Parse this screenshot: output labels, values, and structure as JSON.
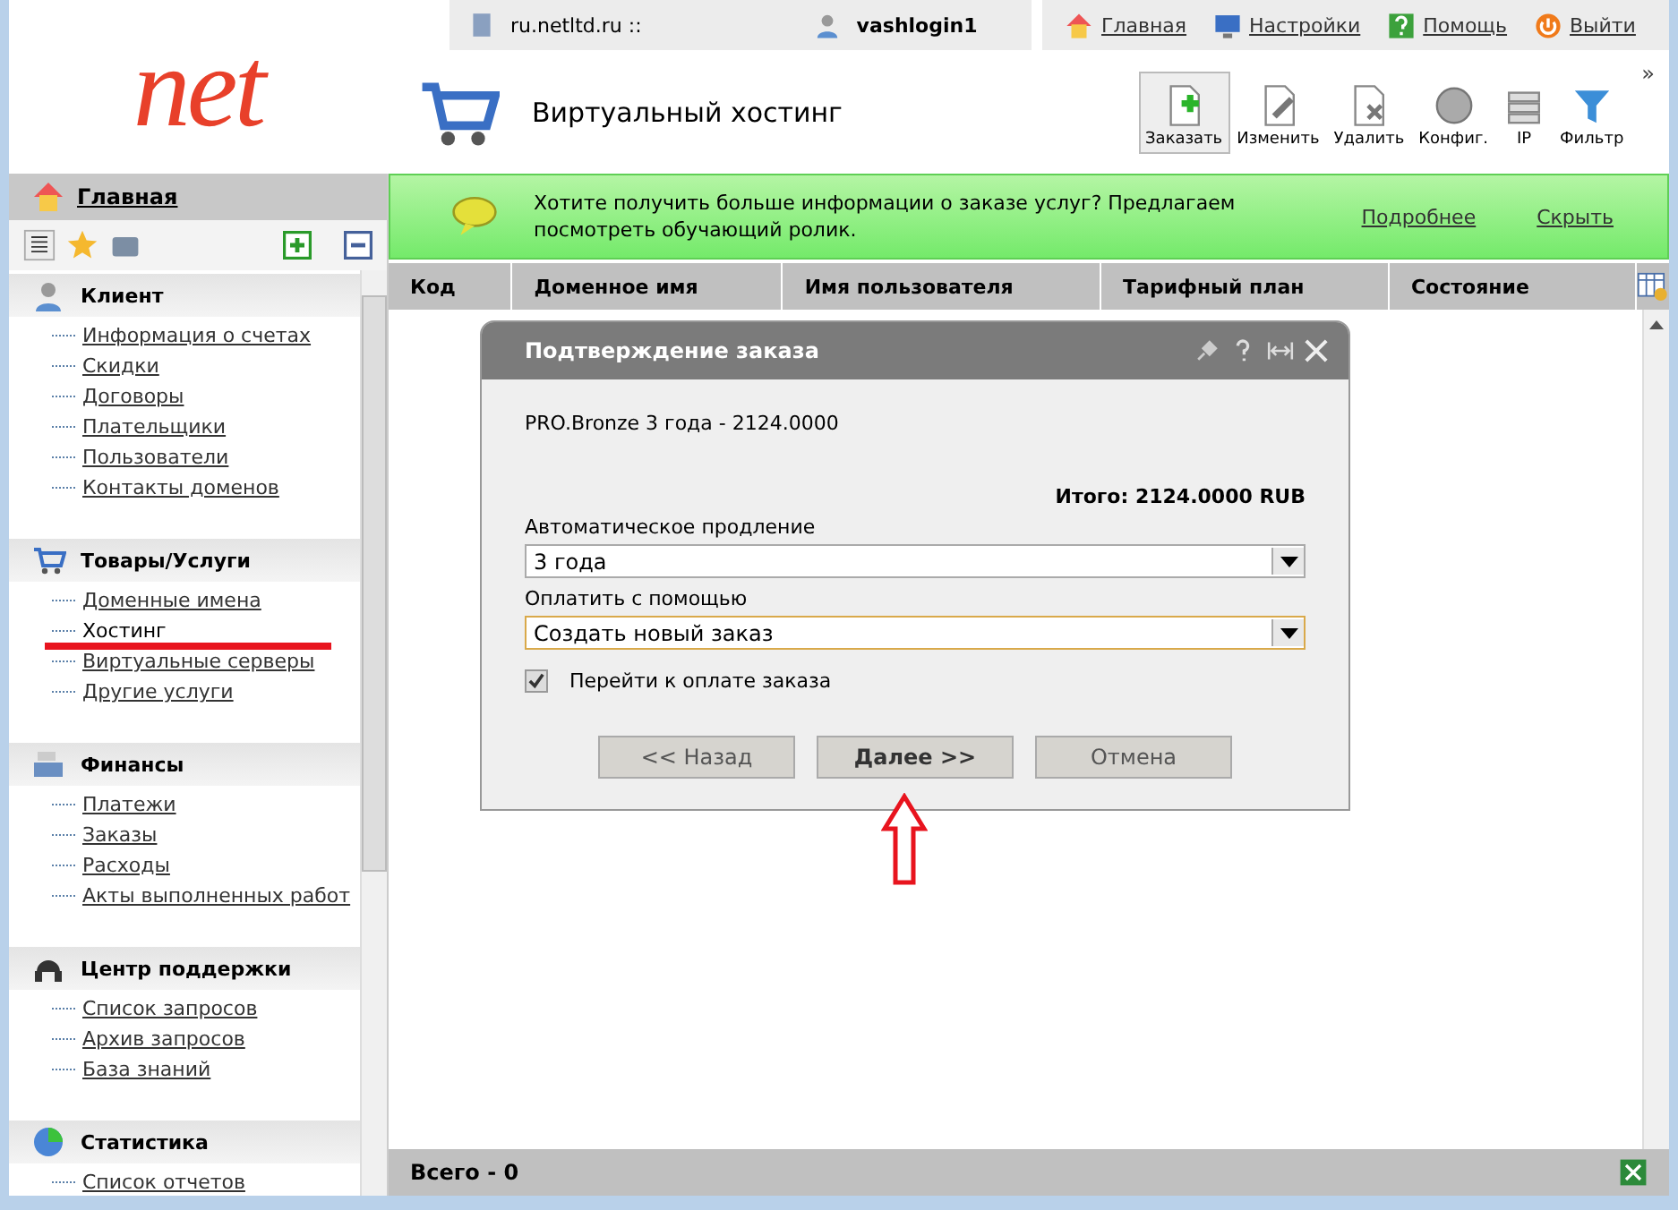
{
  "logo": {
    "text": "net"
  },
  "top_bar": {
    "site": "ru.netltd.ru ::",
    "user": "vashlogin1",
    "links": [
      {
        "label": "Главная"
      },
      {
        "label": "Настройки"
      },
      {
        "label": "Помощь"
      },
      {
        "label": "Выйти"
      }
    ]
  },
  "page_title": "Виртуальный хостинг",
  "toolbar": {
    "buttons": [
      {
        "label": "Заказать",
        "selected": true
      },
      {
        "label": "Изменить",
        "selected": false
      },
      {
        "label": "Удалить",
        "selected": false
      },
      {
        "label": "Конфиг.",
        "selected": false
      },
      {
        "label": "IP",
        "selected": false
      },
      {
        "label": "Фильтр",
        "selected": false
      }
    ],
    "more": "»"
  },
  "sidebar": {
    "home": "Главная",
    "sections": [
      {
        "title": "Клиент",
        "items": [
          {
            "label": "Информация о счетах",
            "selected": false
          },
          {
            "label": "Скидки",
            "selected": false
          },
          {
            "label": "Договоры",
            "selected": false
          },
          {
            "label": "Плательщики",
            "selected": false
          },
          {
            "label": "Пользователи",
            "selected": false
          },
          {
            "label": "Контакты доменов",
            "selected": false
          }
        ]
      },
      {
        "title": "Товары/Услуги",
        "items": [
          {
            "label": "Доменные имена",
            "selected": false
          },
          {
            "label": "Хостинг",
            "selected": true
          },
          {
            "label": "Виртуальные серверы",
            "selected": false
          },
          {
            "label": "Другие услуги",
            "selected": false
          }
        ]
      },
      {
        "title": "Финансы",
        "items": [
          {
            "label": "Платежи",
            "selected": false
          },
          {
            "label": "Заказы",
            "selected": false
          },
          {
            "label": "Расходы",
            "selected": false
          },
          {
            "label": "Акты выполненных работ",
            "selected": false
          }
        ]
      },
      {
        "title": "Центр поддержки",
        "items": [
          {
            "label": "Список запросов",
            "selected": false
          },
          {
            "label": "Архив запросов",
            "selected": false
          },
          {
            "label": "База знаний",
            "selected": false
          }
        ]
      },
      {
        "title": "Статистика",
        "items": [
          {
            "label": "Список отчетов",
            "selected": false
          }
        ]
      }
    ]
  },
  "banner": {
    "text": "Хотите получить больше информации о заказе услуг? Предлагаем посмотреть обучающий ролик.",
    "more": "Подробнее",
    "hide": "Скрыть"
  },
  "table": {
    "columns": [
      "Код",
      "Доменное имя",
      "Имя пользователя",
      "Тарифный план",
      "Состояние"
    ]
  },
  "status_bar": "Всего - 0",
  "dialog": {
    "title": "Подтверждение заказа",
    "product": "PRO.Bronze 3 года - 2124.0000",
    "total": "Итого: 2124.0000 RUB",
    "fields": [
      {
        "label": "Автоматическое продление",
        "value": "3 года",
        "focused": false
      },
      {
        "label": "Оплатить с помощью",
        "value": "Создать новый заказ",
        "focused": true
      }
    ],
    "checkbox": {
      "label": "Перейти к оплате заказа",
      "checked": true
    },
    "buttons": [
      {
        "label": "<< Назад",
        "primary": false
      },
      {
        "label": "Далее >>",
        "primary": true
      },
      {
        "label": "Отмена",
        "primary": false
      }
    ]
  }
}
